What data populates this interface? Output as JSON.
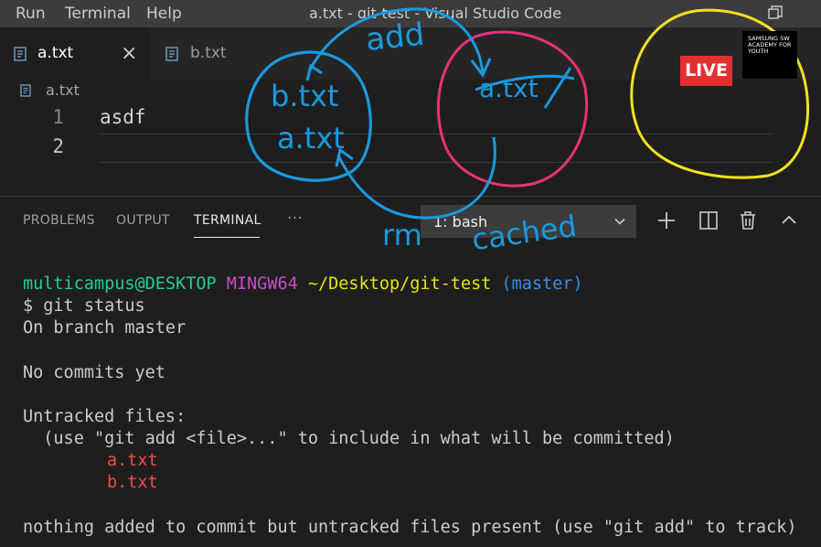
{
  "menu": {
    "items": [
      "Run",
      "Terminal",
      "Help"
    ],
    "window_title": "a.txt - git-test - Visual Studio Code"
  },
  "tabs": [
    {
      "label": "a.txt",
      "active": true,
      "close_icon": "close-icon"
    },
    {
      "label": "b.txt",
      "active": false
    }
  ],
  "breadcrumb": {
    "file": "a.txt"
  },
  "editor": {
    "lines": [
      {
        "number": "1",
        "text": "asdf"
      },
      {
        "number": "2",
        "text": ""
      }
    ]
  },
  "panel": {
    "tabs": [
      "PROBLEMS",
      "OUTPUT",
      "TERMINAL"
    ],
    "more": "···",
    "terminal_select": "1: bash",
    "actions": [
      "plus-icon",
      "split-icon",
      "trash-icon",
      "chevron-up-icon"
    ]
  },
  "terminal": {
    "prompt": {
      "user": "multicampus@DESKTOP",
      "shell": "MINGW64",
      "path": "~/Desktop/git-test",
      "branch": "(master)"
    },
    "command": "$ git status",
    "on_branch": "On branch master",
    "no_commits": "No commits yet",
    "untracked_header": "Untracked files:",
    "hint": "  (use \"git add <file>...\" to include in what will be committed)",
    "untracked_files": [
      "a.txt",
      "b.txt"
    ],
    "footer": "nothing added to commit but untracked files present (use \"git add\" to track)"
  },
  "annotations": {
    "working_files": [
      "b.txt",
      "a.txt"
    ],
    "staged_file": "a.txt",
    "arrow_top": "add",
    "arrow_bottom_left": "rm",
    "arrow_bottom_right": "cached"
  },
  "stream": {
    "live_label": "LIVE",
    "logo_text": "SAMSUNG SW ACADEMY FOR YOUTH"
  },
  "colors": {
    "prompt_user": "#23d18b",
    "prompt_shell": "#c94dc9",
    "prompt_path": "#e5e510",
    "prompt_branch": "#3b8eea",
    "untracked": "#f14c4c",
    "ink_blue": "#1a9ae0",
    "ink_pink": "#e8327a",
    "ink_yellow": "#f2e21f"
  }
}
